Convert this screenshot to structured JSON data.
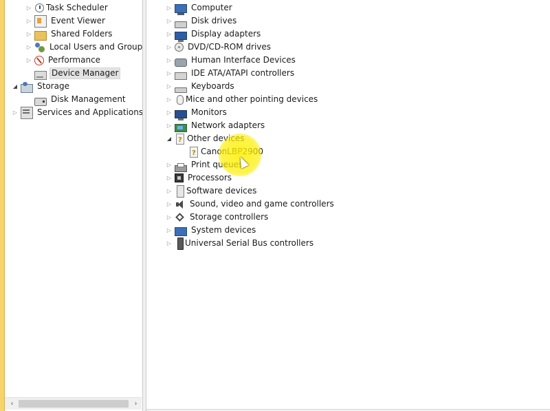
{
  "left_tree": {
    "items": [
      {
        "label": "Task Scheduler",
        "icon": "task-scheduler-icon",
        "expander": "closed",
        "indent": 1
      },
      {
        "label": "Event Viewer",
        "icon": "event-viewer-icon",
        "expander": "closed",
        "indent": 1
      },
      {
        "label": "Shared Folders",
        "icon": "shared-folders-icon",
        "expander": "closed",
        "indent": 1
      },
      {
        "label": "Local Users and Groups",
        "icon": "local-users-icon",
        "expander": "closed",
        "indent": 1
      },
      {
        "label": "Performance",
        "icon": "performance-icon",
        "expander": "closed",
        "indent": 1
      },
      {
        "label": "Device Manager",
        "icon": "device-manager-icon",
        "expander": "none",
        "indent": 1,
        "selected": true
      },
      {
        "label": "Storage",
        "icon": "storage-icon",
        "expander": "open",
        "indent": 0
      },
      {
        "label": "Disk Management",
        "icon": "disk-management-icon",
        "expander": "none",
        "indent": 1
      },
      {
        "label": "Services and Applications",
        "icon": "services-icon",
        "expander": "closed",
        "indent": 0
      }
    ]
  },
  "device_tree": {
    "items": [
      {
        "label": "Computer",
        "icon": "computer-icon",
        "expander": "closed"
      },
      {
        "label": "Disk drives",
        "icon": "disk-drive-icon",
        "expander": "closed"
      },
      {
        "label": "Display adapters",
        "icon": "display-adapter-icon",
        "expander": "closed"
      },
      {
        "label": "DVD/CD-ROM drives",
        "icon": "dvd-icon",
        "expander": "closed"
      },
      {
        "label": "Human Interface Devices",
        "icon": "hid-icon",
        "expander": "closed"
      },
      {
        "label": "IDE ATA/ATAPI controllers",
        "icon": "ide-controller-icon",
        "expander": "closed"
      },
      {
        "label": "Keyboards",
        "icon": "keyboard-icon",
        "expander": "closed"
      },
      {
        "label": "Mice and other pointing devices",
        "icon": "mouse-icon",
        "expander": "closed"
      },
      {
        "label": "Monitors",
        "icon": "monitor-icon",
        "expander": "closed"
      },
      {
        "label": "Network adapters",
        "icon": "network-adapter-icon",
        "expander": "closed"
      },
      {
        "label": "Other devices",
        "icon": "other-devices-icon",
        "expander": "open"
      },
      {
        "label": "CanonLBP2900",
        "icon": "unknown-device-icon",
        "expander": "none",
        "child": true
      },
      {
        "label": "Print queues",
        "icon": "printer-icon",
        "expander": "closed"
      },
      {
        "label": "Processors",
        "icon": "processor-icon",
        "expander": "closed"
      },
      {
        "label": "Software devices",
        "icon": "software-device-icon",
        "expander": "closed"
      },
      {
        "label": "Sound, video and game controllers",
        "icon": "sound-icon",
        "expander": "closed"
      },
      {
        "label": "Storage controllers",
        "icon": "storage-controller-icon",
        "expander": "closed"
      },
      {
        "label": "System devices",
        "icon": "system-devices-icon",
        "expander": "closed"
      },
      {
        "label": "Universal Serial Bus controllers",
        "icon": "usb-icon",
        "expander": "closed"
      }
    ]
  },
  "scrollbar": {
    "left_arrow": "‹",
    "right_arrow": "›"
  },
  "colors": {
    "selection": "#e3e3e3",
    "highlight": "#ffee00",
    "window_edge": "#f6d36b"
  }
}
